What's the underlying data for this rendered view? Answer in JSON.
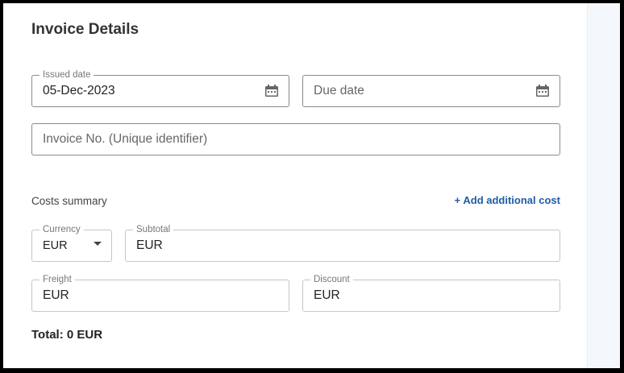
{
  "section": {
    "title": "Invoice Details"
  },
  "issued_date": {
    "label": "Issued date",
    "value": "05-Dec-2023"
  },
  "due_date": {
    "placeholder": "Due date"
  },
  "invoice_no": {
    "placeholder": "Invoice No. (Unique identifier)"
  },
  "costs": {
    "title": "Costs summary",
    "add_link": "+ Add additional cost",
    "currency": {
      "label": "Currency",
      "value": "EUR"
    },
    "subtotal": {
      "label": "Subtotal",
      "value": "EUR"
    },
    "freight": {
      "label": "Freight",
      "value": "EUR"
    },
    "discount": {
      "label": "Discount",
      "value": "EUR"
    },
    "total": "Total: 0 EUR"
  },
  "colors": {
    "link": "#1d5ca5",
    "side_panel": "#f4f8fc"
  }
}
